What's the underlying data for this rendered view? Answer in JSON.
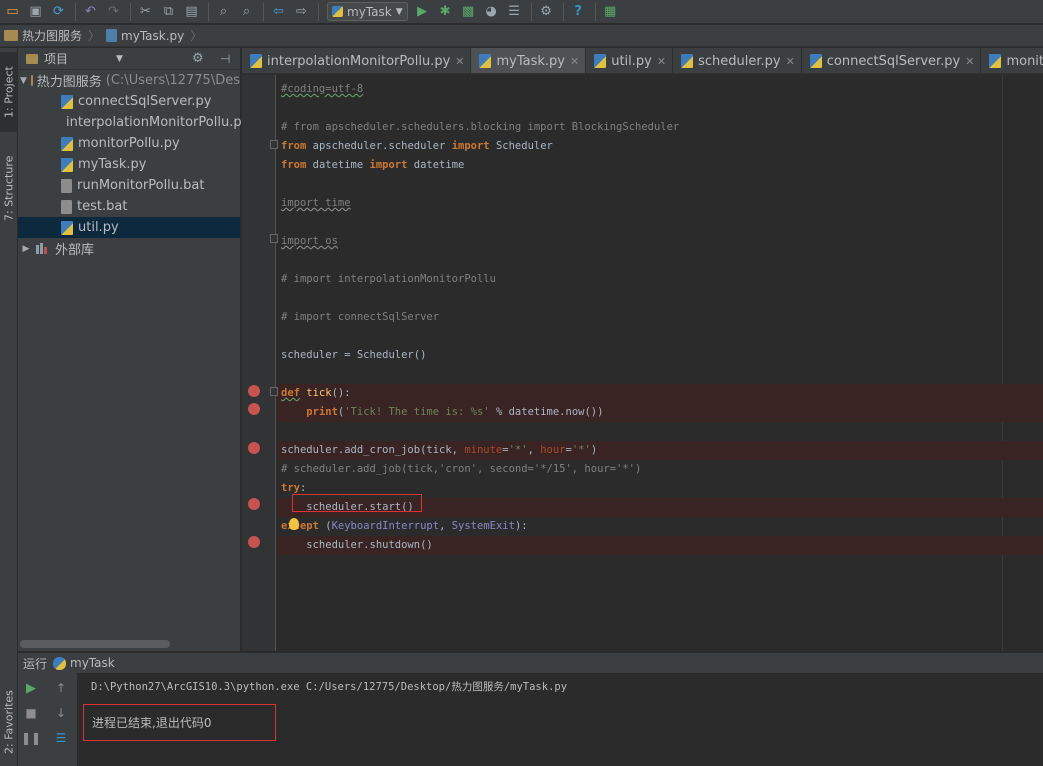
{
  "toolbar": {
    "run_config": "myTask",
    "icons": [
      "open-folder-icon",
      "save-icon",
      "sync-icon",
      "undo-icon",
      "redo-icon",
      "cut-icon",
      "copy-icon",
      "paste-icon",
      "find-icon",
      "replace-icon",
      "back-icon",
      "forward-icon",
      "run-icon",
      "debug-icon",
      "run-coverage-icon",
      "profile-icon",
      "tasks-icon",
      "settings-icon",
      "help-icon",
      "sdk-manager-icon"
    ]
  },
  "breadcrumb": {
    "project": "热力图服务",
    "file": "myTask.py"
  },
  "left_strip": {
    "project_tab": "1: Project",
    "structure_tab": "7: Structure",
    "favorites_tab": "2: Favorites"
  },
  "project_panel": {
    "title": "项目",
    "root_name": "热力图服务",
    "root_path": "(C:\\Users\\12775\\Des",
    "files": [
      {
        "name": "connectSqlServer.py",
        "type": "py"
      },
      {
        "name": "interpolationMonitorPollu.py",
        "type": "py"
      },
      {
        "name": "monitorPollu.py",
        "type": "py"
      },
      {
        "name": "myTask.py",
        "type": "py"
      },
      {
        "name": "runMonitorPollu.bat",
        "type": "bat"
      },
      {
        "name": "test.bat",
        "type": "bat"
      },
      {
        "name": "util.py",
        "type": "py"
      }
    ],
    "selected_file": "util.py",
    "external_libs": "外部库"
  },
  "tabs": [
    {
      "label": "interpolationMonitorPollu.py",
      "active": false
    },
    {
      "label": "myTask.py",
      "active": true
    },
    {
      "label": "util.py",
      "active": false
    },
    {
      "label": "scheduler.py",
      "active": false
    },
    {
      "label": "connectSqlServer.py",
      "active": false
    },
    {
      "label": "monitorPollu.py",
      "active": false
    }
  ],
  "code": {
    "l1": "#coding=utf-8",
    "l2": "# from apscheduler.schedulers.blocking import BlockingScheduler",
    "l3_a": "from",
    "l3_b": " apscheduler.scheduler ",
    "l3_c": "import",
    "l3_d": " Scheduler",
    "l4_a": "from",
    "l4_b": " datetime ",
    "l4_c": "import",
    "l4_d": " datetime",
    "l5": "import time",
    "l6": "import os",
    "l7": "# import interpolationMonitorPollu",
    "l8": "# import connectSqlServer",
    "l9": "scheduler = Scheduler()",
    "l10_a": "def",
    "l10_b": " tick",
    "l10_c": "():",
    "l11_a": "    ",
    "l11_b": "print",
    "l11_c": "(",
    "l11_d": "'Tick! The time is: %s'",
    "l11_e": " % datetime.now())",
    "l12_a": "scheduler.add_cron_job(tick, ",
    "l12_b": "minute",
    "l12_c": "=",
    "l12_d": "'*'",
    "l12_e": ", ",
    "l12_f": "hour",
    "l12_g": "=",
    "l12_h": "'*'",
    "l12_i": ")",
    "l13": "# scheduler.add_job(tick,'cron', second='*/15', hour='*')",
    "l14_a": "try",
    "l14_b": ":",
    "l15": "    scheduler.start()",
    "l16_a": "except",
    "l16_b": " (",
    "l16_c": "KeyboardInterrupt",
    "l16_d": ", ",
    "l16_e": "SystemExit",
    "l16_f": "):",
    "l17": "    scheduler.shutdown()"
  },
  "run_panel": {
    "label": "运行",
    "config": "myTask",
    "command": "D:\\Python27\\ArcGIS10.3\\python.exe C:/Users/12775/Desktop/热力图服务/myTask.py",
    "exit_message": "进程已结束,退出代码0"
  }
}
